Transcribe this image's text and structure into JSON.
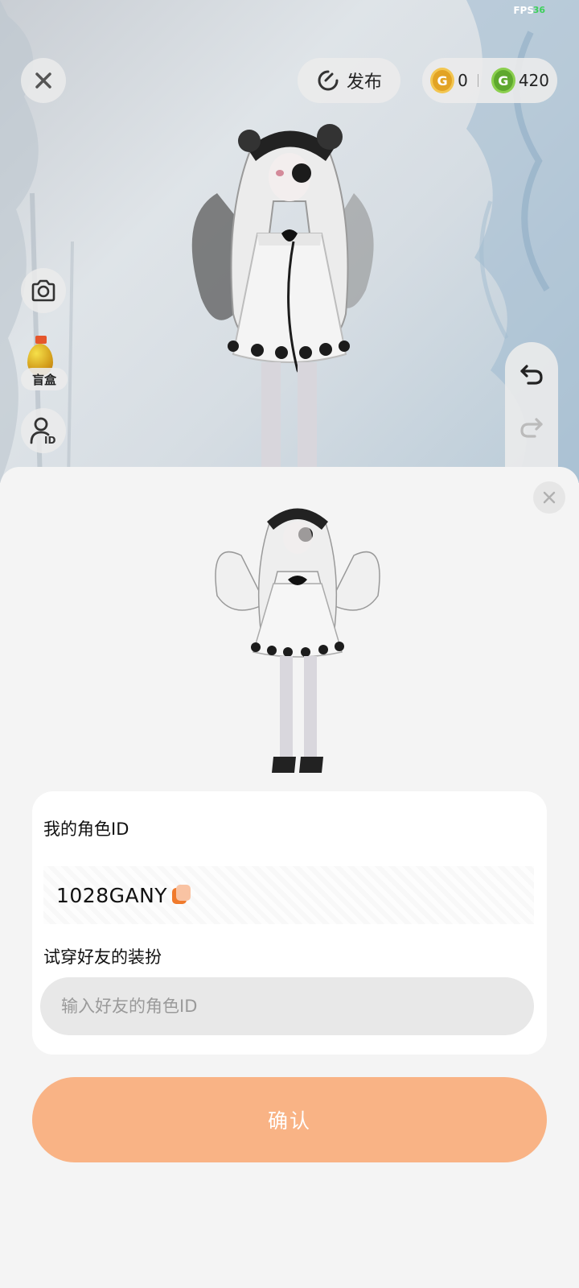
{
  "status": {
    "fps_label": "FPS",
    "fps_value": "36"
  },
  "toolbar": {
    "close_icon": "close-icon",
    "publish_label": "发布",
    "publish_icon": "publish-icon"
  },
  "currency": {
    "gold_icon": "gold-coin-icon",
    "gold_amount": "0",
    "green_icon": "green-coin-icon",
    "green_amount": "420"
  },
  "left_tools": {
    "camera_icon": "camera-icon",
    "blindbox_label": "盲盒",
    "id_icon": "user-id-icon"
  },
  "history": {
    "undo_icon": "undo-icon",
    "redo_icon": "redo-icon"
  },
  "sheet": {
    "my_id_label": "我的角色ID",
    "my_id_value": "1028GANY",
    "try_on_label": "试穿好友的装扮",
    "friend_id_placeholder": "输入好友的角色ID",
    "friend_id_value": "",
    "confirm_label": "确认"
  },
  "colors": {
    "accent": "#f9b385",
    "copy_icon": "#f07a2c",
    "fps_value": "#3cd05a"
  }
}
